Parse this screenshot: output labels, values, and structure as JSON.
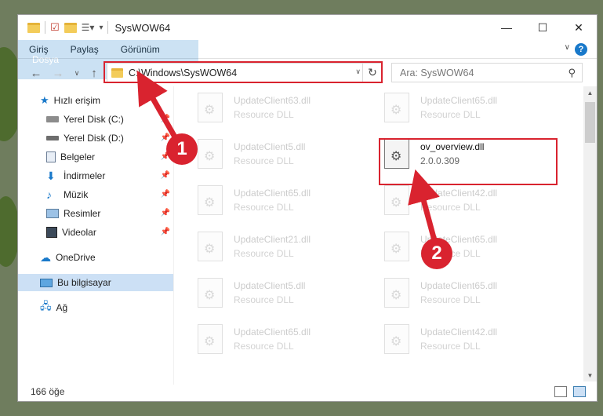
{
  "window": {
    "title": "SysWOW64",
    "buttons": {
      "minimize": "—",
      "maximize": "☐",
      "close": "✕"
    }
  },
  "ribbon": {
    "tabs": [
      "Dosya",
      "Giriş",
      "Paylaş",
      "Görünüm"
    ],
    "help": "?"
  },
  "address": {
    "path": "C:\\Windows\\SysWOW64",
    "search_placeholder": "Ara: SysWOW64"
  },
  "sidebar": {
    "items": [
      {
        "label": "Hızlı erişim",
        "icon": "star-icon",
        "pinned": false
      },
      {
        "label": "Yerel Disk (C:)",
        "icon": "drive-icon",
        "pinned": true
      },
      {
        "label": "Yerel Disk (D:)",
        "icon": "drive-icon",
        "pinned": true
      },
      {
        "label": "Belgeler",
        "icon": "documents-icon",
        "pinned": true
      },
      {
        "label": "İndirmeler",
        "icon": "download-icon",
        "pinned": true
      },
      {
        "label": "Müzik",
        "icon": "music-icon",
        "pinned": true
      },
      {
        "label": "Resimler",
        "icon": "pictures-icon",
        "pinned": true
      },
      {
        "label": "Videolar",
        "icon": "videos-icon",
        "pinned": true
      },
      {
        "label": "OneDrive",
        "icon": "cloud-icon",
        "pinned": false
      },
      {
        "label": "Bu bilgisayar",
        "icon": "computer-icon",
        "pinned": false
      },
      {
        "label": "Ağ",
        "icon": "network-icon",
        "pinned": false
      }
    ]
  },
  "files": {
    "left": [
      {
        "name": "UpdateClient63.dll",
        "type": "Resource DLL"
      },
      {
        "name": "UpdateClient5.dll",
        "type": "Resource DLL"
      },
      {
        "name": "UpdateClient65.dll",
        "type": "Resource DLL"
      },
      {
        "name": "UpdateClient21.dll",
        "type": "Resource DLL"
      },
      {
        "name": "UpdateClient5.dll",
        "type": "Resource DLL"
      },
      {
        "name": "UpdateClient65.dll",
        "type": "Resource DLL"
      }
    ],
    "right": [
      {
        "name": "UpdateClient65.dll",
        "type": "Resource DLL"
      },
      {
        "name": "ov_overview.dll",
        "type": "2.0.0.309"
      },
      {
        "name": "UpdateClient42.dll",
        "type": "Resource DLL"
      },
      {
        "name": "UpdateClient65.dll",
        "type": "Resource DLL"
      },
      {
        "name": "UpdateClient65.dll",
        "type": "Resource DLL"
      },
      {
        "name": "UpdateClient42.dll",
        "type": "Resource DLL"
      }
    ]
  },
  "status": {
    "count": "166 öğe"
  },
  "markers": {
    "one": "1",
    "two": "2"
  },
  "colors": {
    "accent": "#1979ca",
    "highlight_red": "#d9232f",
    "selected_bg": "#cce0f5"
  }
}
